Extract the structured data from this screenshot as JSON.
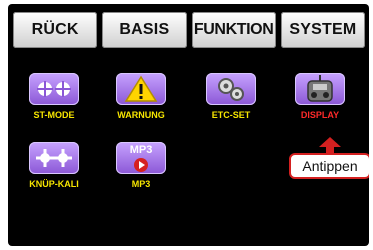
{
  "tabs": [
    {
      "label": "RÜCK"
    },
    {
      "label": "BASIS"
    },
    {
      "label": "FUNKTION"
    },
    {
      "label": "SYSTEM"
    }
  ],
  "icons": [
    {
      "label": "ST-MODE",
      "icon": "stick-mode-icon"
    },
    {
      "label": "WARNUNG",
      "icon": "warning-icon"
    },
    {
      "label": "ETC-SET",
      "icon": "gears-icon"
    },
    {
      "label": "DISPLAY",
      "icon": "transmitter-icon",
      "highlight": true
    },
    {
      "label": "KNÜP-KALI",
      "icon": "stick-calibration-icon"
    },
    {
      "label": "MP3",
      "icon": "mp3-icon",
      "badge": "MP3"
    }
  ],
  "tooltip": {
    "label": "Antippen"
  },
  "colors": {
    "label": "#f7e600",
    "highlight_label": "#ff2a2a",
    "icon_bg": "#a06fe6",
    "background": "#000000"
  }
}
